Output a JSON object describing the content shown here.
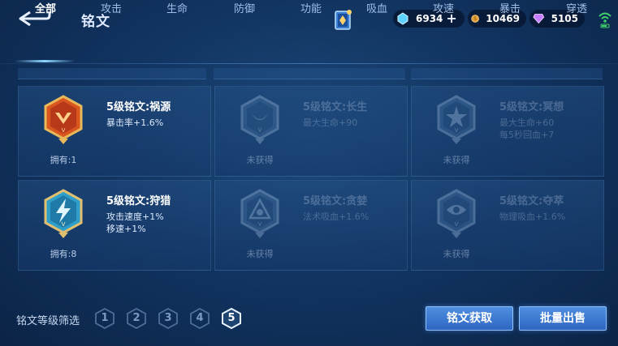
{
  "header": {
    "title": "铭文",
    "currencies": [
      {
        "name": "diamond",
        "value": "6934"
      },
      {
        "name": "gold",
        "value": "10469"
      },
      {
        "name": "gem",
        "value": "5105"
      }
    ]
  },
  "tabs": [
    {
      "label": "全部",
      "active": true
    },
    {
      "label": "攻击",
      "active": false
    },
    {
      "label": "生命",
      "active": false
    },
    {
      "label": "防御",
      "active": false
    },
    {
      "label": "功能",
      "active": false
    },
    {
      "label": "吸血",
      "active": false
    },
    {
      "label": "攻速",
      "active": false
    },
    {
      "label": "暴击",
      "active": false
    },
    {
      "label": "穿透",
      "active": false
    }
  ],
  "runes": [
    {
      "name": "5级铭文:祸源",
      "stats": [
        "暴击率+1.6%"
      ],
      "owned_text": "拥有:1",
      "locked": false,
      "color": "#d9571f"
    },
    {
      "name": "5级铭文:长生",
      "stats": [
        "最大生命+90"
      ],
      "owned_text": "未获得",
      "locked": true,
      "color": "#5a7fa8"
    },
    {
      "name": "5级铭文:冥想",
      "stats": [
        "最大生命+60",
        "每5秒回血+7"
      ],
      "owned_text": "未获得",
      "locked": true,
      "color": "#5a7fa8"
    },
    {
      "name": "5级铭文:狩猎",
      "stats": [
        "攻击速度+1%",
        "移速+1%"
      ],
      "owned_text": "拥有:8",
      "locked": false,
      "color": "#2f9fc9"
    },
    {
      "name": "5级铭文:贪婪",
      "stats": [
        "法术吸血+1.6%"
      ],
      "owned_text": "未获得",
      "locked": true,
      "color": "#5a7fa8"
    },
    {
      "name": "5级铭文:夺萃",
      "stats": [
        "物理吸血+1.6%"
      ],
      "owned_text": "未获得",
      "locked": true,
      "color": "#5a7fa8"
    }
  ],
  "filter": {
    "label": "铭文等级筛选",
    "levels": [
      "1",
      "2",
      "3",
      "4",
      "5"
    ],
    "selected": "5"
  },
  "buttons": {
    "acquire": "铭文获取",
    "bulk_sell": "批量出售"
  },
  "colors": {
    "accent": "#8fd6ff",
    "button": "#3a78d2",
    "gold_rim": "#d8a84a"
  }
}
